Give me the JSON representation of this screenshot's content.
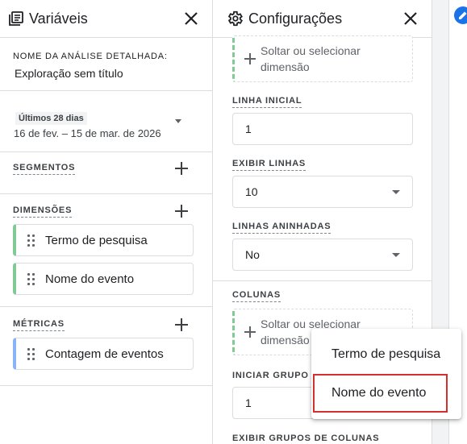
{
  "variables_panel": {
    "title": "Variáveis",
    "name_label": "NOME DA ANÁLISE DETALHADA:",
    "name_value": "Exploração sem título",
    "date_label": "Últimos 28 dias",
    "date_range": "16 de fev. – 15 de mar. de 2026",
    "segments_label": "SEGMENTOS",
    "dimensions_label": "DIMENSÕES",
    "dimensions": [
      "Termo de pesquisa",
      "Nome do evento"
    ],
    "metrics_label": "MÉTRICAS",
    "metrics": [
      "Contagem de eventos"
    ],
    "colors": {
      "dimension_accent": "#81c995",
      "metric_accent": "#8ab4f8"
    }
  },
  "config_panel": {
    "title": "Configurações",
    "rows_drop_text": "Soltar ou selecionar dimensão",
    "start_row_label": "LINHA INICIAL",
    "start_row_value": "1",
    "show_rows_label": "EXIBIR LINHAS",
    "show_rows_value": "10",
    "nested_rows_label": "LINHAS ANINHADAS",
    "nested_rows_value": "No",
    "columns_label": "COLUNAS",
    "columns_drop_text": "Soltar ou selecionar dimensão",
    "start_col_group_label": "INICIAR GRUPO D",
    "start_col_group_value": "1",
    "show_col_groups_label": "EXIBIR GRUPOS DE COLUNAS"
  },
  "dropdown_menu": {
    "items": [
      "Termo de pesquisa",
      "Nome do evento"
    ],
    "highlighted_index": 1,
    "highlight_color": "#d32f2f"
  },
  "icons": {
    "variables_icon": "list-box-icon",
    "settings_icon": "gear-icon",
    "close_icon": "close-icon",
    "edit_icon": "pencil-icon"
  }
}
